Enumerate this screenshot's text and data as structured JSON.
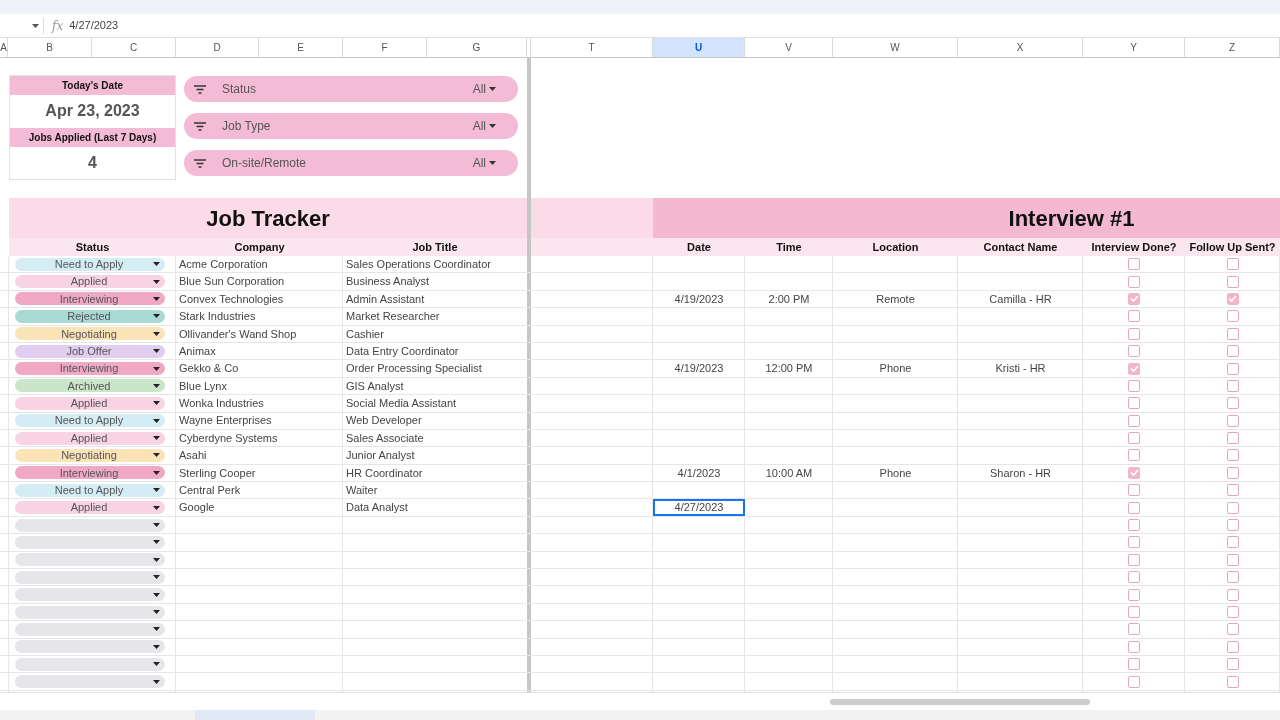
{
  "formula_bar": {
    "icon": "fx",
    "value": "4/27/2023"
  },
  "columns": [
    {
      "letter": "A",
      "selected": false
    },
    {
      "letter": "B",
      "selected": false
    },
    {
      "letter": "C",
      "selected": false
    },
    {
      "letter": "D",
      "selected": false
    },
    {
      "letter": "E",
      "selected": false
    },
    {
      "letter": "F",
      "selected": false
    },
    {
      "letter": "G",
      "selected": false
    },
    {
      "letter": "T",
      "selected": false
    },
    {
      "letter": "U",
      "selected": true
    },
    {
      "letter": "V",
      "selected": false
    },
    {
      "letter": "W",
      "selected": false
    },
    {
      "letter": "X",
      "selected": false
    },
    {
      "letter": "Y",
      "selected": false
    },
    {
      "letter": "Z",
      "selected": false
    }
  ],
  "summary": {
    "date_label": "Today's Date",
    "date_value": "Apr 23, 2023",
    "count_label": "Jobs Applied (Last 7 Days)",
    "count_value": "4"
  },
  "filters": [
    {
      "label": "Status",
      "value": "All"
    },
    {
      "label": "Job Type",
      "value": "All"
    },
    {
      "label": "On-site/Remote",
      "value": "All"
    }
  ],
  "tracker": {
    "title": "Job Tracker",
    "columns": [
      "Status",
      "Company",
      "Job Title"
    ]
  },
  "interview": {
    "title": "Interview #1",
    "columns": [
      "Date",
      "Time",
      "Location",
      "Contact Name",
      "Interview Done?",
      "Follow Up Sent?"
    ]
  },
  "rows": [
    {
      "status": "Need to Apply",
      "color": "#d4ecf3",
      "company": "Acme Corporation",
      "job_title": "Sales Operations Coordinator",
      "interview_done": false,
      "follow_up_sent": false,
      "date_selected": false
    },
    {
      "status": "Applied",
      "color": "#f8d3e3",
      "company": "Blue Sun Corporation",
      "job_title": "Business Analyst",
      "interview_done": false,
      "follow_up_sent": false,
      "date_selected": false
    },
    {
      "status": "Interviewing",
      "color": "#f0a8c4",
      "company": "Convex Technologies",
      "job_title": "Admin Assistant",
      "date": "4/19/2023",
      "time": "2:00 PM",
      "location": "Remote",
      "contact": "Camilla - HR",
      "interview_done": true,
      "follow_up_sent": true,
      "date_selected": false
    },
    {
      "status": "Rejected",
      "color": "#a9d9d5",
      "company": "Stark Industries",
      "job_title": "Market Researcher",
      "interview_done": false,
      "follow_up_sent": false,
      "date_selected": false
    },
    {
      "status": "Negotiating",
      "color": "#fbe3b8",
      "company": "Ollivander's Wand Shop",
      "job_title": "Cashier",
      "interview_done": false,
      "follow_up_sent": false,
      "date_selected": false
    },
    {
      "status": "Job Offer",
      "color": "#e1cdf0",
      "company": "Animax",
      "job_title": "Data Entry Coordinator",
      "interview_done": false,
      "follow_up_sent": false,
      "date_selected": false
    },
    {
      "status": "Interviewing",
      "color": "#f0a8c4",
      "company": "Gekko & Co",
      "job_title": "Order Processing Specialist",
      "date": "4/19/2023",
      "time": "12:00 PM",
      "location": "Phone",
      "contact": "Kristi - HR",
      "interview_done": true,
      "follow_up_sent": false,
      "date_selected": false
    },
    {
      "status": "Archived",
      "color": "#c9e6c9",
      "company": "Blue Lynx",
      "job_title": "GIS Analyst",
      "interview_done": false,
      "follow_up_sent": false,
      "date_selected": false
    },
    {
      "status": "Applied",
      "color": "#f8d3e3",
      "company": "Wonka Industries",
      "job_title": "Social Media Assistant",
      "interview_done": false,
      "follow_up_sent": false,
      "date_selected": false
    },
    {
      "status": "Need to Apply",
      "color": "#d4ecf3",
      "company": "Wayne Enterprises",
      "job_title": "Web Developer",
      "interview_done": false,
      "follow_up_sent": false,
      "date_selected": false
    },
    {
      "status": "Applied",
      "color": "#f8d3e3",
      "company": "Cyberdyne Systems",
      "job_title": "Sales Associate",
      "interview_done": false,
      "follow_up_sent": false,
      "date_selected": false
    },
    {
      "status": "Negotiating",
      "color": "#fbe3b8",
      "company": "Asahi",
      "job_title": "Junior Analyst",
      "interview_done": false,
      "follow_up_sent": false,
      "date_selected": false
    },
    {
      "status": "Interviewing",
      "color": "#f0a8c4",
      "company": "Sterling Cooper",
      "job_title": "HR Coordinator",
      "date": "4/1/2023",
      "time": "10:00 AM",
      "location": "Phone",
      "contact": "Sharon - HR",
      "interview_done": true,
      "follow_up_sent": false,
      "date_selected": false
    },
    {
      "status": "Need to Apply",
      "color": "#d4ecf3",
      "company": "Central Perk",
      "job_title": "Waiter",
      "interview_done": false,
      "follow_up_sent": false,
      "date_selected": false
    },
    {
      "status": "Applied",
      "color": "#f8d3e3",
      "company": "Google",
      "job_title": "Data Analyst",
      "date": "4/27/2023",
      "interview_done": false,
      "follow_up_sent": false,
      "date_selected": true
    },
    {
      "color": "#e6e6ea",
      "interview_done": false,
      "follow_up_sent": false,
      "date_selected": false
    },
    {
      "color": "#e6e6ea",
      "interview_done": false,
      "follow_up_sent": false,
      "date_selected": false
    },
    {
      "color": "#e6e6ea",
      "interview_done": false,
      "follow_up_sent": false,
      "date_selected": false
    },
    {
      "color": "#e6e6ea",
      "interview_done": false,
      "follow_up_sent": false,
      "date_selected": false
    },
    {
      "color": "#e6e6ea",
      "interview_done": false,
      "follow_up_sent": false,
      "date_selected": false
    },
    {
      "color": "#e6e6ea",
      "interview_done": false,
      "follow_up_sent": false,
      "date_selected": false
    },
    {
      "color": "#e6e6ea",
      "interview_done": false,
      "follow_up_sent": false,
      "date_selected": false
    },
    {
      "color": "#e6e6ea",
      "interview_done": false,
      "follow_up_sent": false,
      "date_selected": false
    },
    {
      "color": "#e6e6ea",
      "interview_done": false,
      "follow_up_sent": false,
      "date_selected": false
    },
    {
      "color": "#e6e6ea",
      "interview_done": false,
      "follow_up_sent": false,
      "date_selected": false
    }
  ]
}
